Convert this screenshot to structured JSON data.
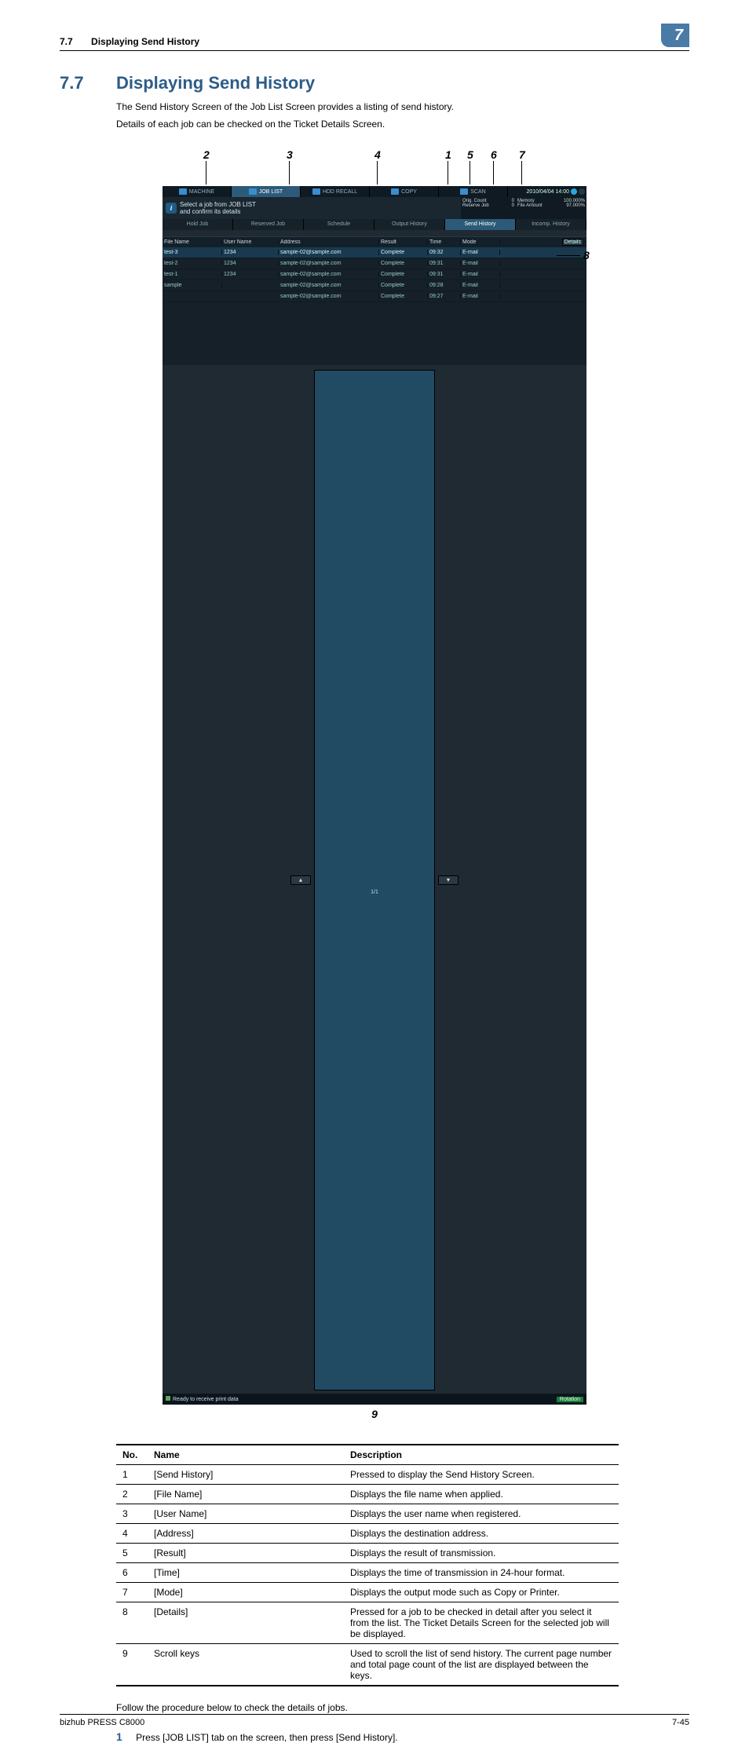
{
  "header": {
    "section_num": "7.7",
    "section_title": "Displaying Send History",
    "chapter": "7"
  },
  "title": {
    "num": "7.7",
    "text": "Displaying Send History"
  },
  "intro": {
    "p1": "The Send History Screen of the Job List Screen provides a listing of send history.",
    "p2": "Details of each job can be checked on the Ticket Details Screen."
  },
  "callouts": {
    "c1": "1",
    "c2": "2",
    "c3": "3",
    "c4": "4",
    "c5": "5",
    "c6": "6",
    "c7": "7",
    "c8": "8",
    "c9": "9"
  },
  "panel": {
    "tabs": {
      "machine": "MACHINE",
      "joblist": "JOB LIST",
      "hdd": "HDD RECALL",
      "copy": "COPY",
      "scan": "SCAN"
    },
    "datetime": "2010/04/04 14:00",
    "message": "Select a job from JOB LIST\nand confirm its details",
    "counts": {
      "orig_label": "Orig. Count",
      "orig": "0",
      "reserve_label": "Reserve Job",
      "reserve": "0"
    },
    "amounts": {
      "mem_label": "Memory",
      "mem": "100.000%",
      "file_label": "File Amount",
      "file": "97.000%"
    },
    "subtabs": {
      "hold": "Hold Job",
      "reserved": "Reserved Job",
      "schedule": "Schedule",
      "output": "Output History",
      "send": "Send History",
      "incomp": "Incomp. History"
    },
    "columns": {
      "file": "File Name",
      "user": "User Name",
      "addr": "Address",
      "result": "Result",
      "time": "Time",
      "mode": "Mode"
    },
    "details_btn": "Details",
    "rows": [
      {
        "file": "test-3",
        "user": "1234",
        "addr": "sample-02@sample.com",
        "result": "Complete",
        "time": "09:32",
        "mode": "E-mail"
      },
      {
        "file": "test-2",
        "user": "1234",
        "addr": "sample-02@sample.com",
        "result": "Complete",
        "time": "09:31",
        "mode": "E-mail"
      },
      {
        "file": "test-1",
        "user": "1234",
        "addr": "sample-02@sample.com",
        "result": "Complete",
        "time": "09:31",
        "mode": "E-mail"
      },
      {
        "file": "sample",
        "user": "",
        "addr": "sample-02@sample.com",
        "result": "Complete",
        "time": "09:28",
        "mode": "E-mail"
      },
      {
        "file": "",
        "user": "",
        "addr": "sample-02@sample.com",
        "result": "Complete",
        "time": "09:27",
        "mode": "E-mail"
      }
    ],
    "pager": "1/1",
    "status": "Ready to receive print data",
    "rotation": "Rotation"
  },
  "desc": {
    "head": {
      "no": "No.",
      "name": "Name",
      "description": "Description"
    },
    "rows": [
      {
        "no": "1",
        "name": "[Send History]",
        "desc": "Pressed to display the Send History Screen."
      },
      {
        "no": "2",
        "name": "[File Name]",
        "desc": "Displays the file name when applied."
      },
      {
        "no": "3",
        "name": "[User Name]",
        "desc": "Displays the user name when registered."
      },
      {
        "no": "4",
        "name": "[Address]",
        "desc": "Displays the destination address."
      },
      {
        "no": "5",
        "name": "[Result]",
        "desc": "Displays the result of transmission."
      },
      {
        "no": "6",
        "name": "[Time]",
        "desc": "Displays the time of transmission in 24-hour format."
      },
      {
        "no": "7",
        "name": "[Mode]",
        "desc": "Displays the output mode such as Copy or Printer."
      },
      {
        "no": "8",
        "name": "[Details]",
        "desc": "Pressed for a job to be checked in detail after you select it from the list. The Ticket Details Screen for the selected job will be displayed."
      },
      {
        "no": "9",
        "name": "Scroll keys",
        "desc": "Used to scroll the list of send history. The current page number and total page count of the list are displayed between the keys."
      }
    ]
  },
  "aftertable": "Follow the procedure below to check the details of jobs.",
  "steps": {
    "s1_num": "1",
    "s1_text": "Press [JOB LIST] tab on the screen, then press [Send History]."
  },
  "footer": {
    "product": "bizhub PRESS C8000",
    "page": "7-45"
  }
}
